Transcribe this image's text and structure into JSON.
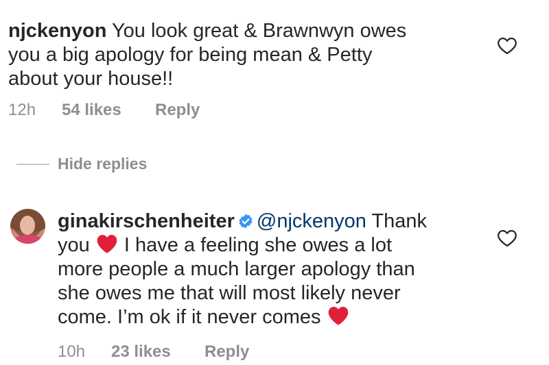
{
  "comments": [
    {
      "username": "njckenyon",
      "lines": [
        " You look great & Brawnwyn owes",
        "you a big apology for being mean & Petty",
        "about your house!!"
      ],
      "time": "12h",
      "likes": "54 likes",
      "reply": "Reply"
    }
  ],
  "hide_replies_label": "Hide replies",
  "reply_comment": {
    "username": "ginakirschenheiter",
    "mention": "@njckenyon",
    "line1_after_mention": " Thank",
    "line2_before_emoji": "you",
    "line2_after_emoji": " I have a feeling she owes a lot",
    "line3": "more people a much larger apology than",
    "line4": "she owes me that will most likely never",
    "line5_before_emoji": "come. I’m ok if it never comes",
    "time": "10h",
    "likes": "23 likes",
    "reply": "Reply"
  },
  "icons": {
    "like": "heart-outline-icon",
    "verified": "verified-badge-icon",
    "emoji": "red-heart-emoji",
    "heart_red": "#e0203a",
    "verified_blue": "#3897f0"
  }
}
